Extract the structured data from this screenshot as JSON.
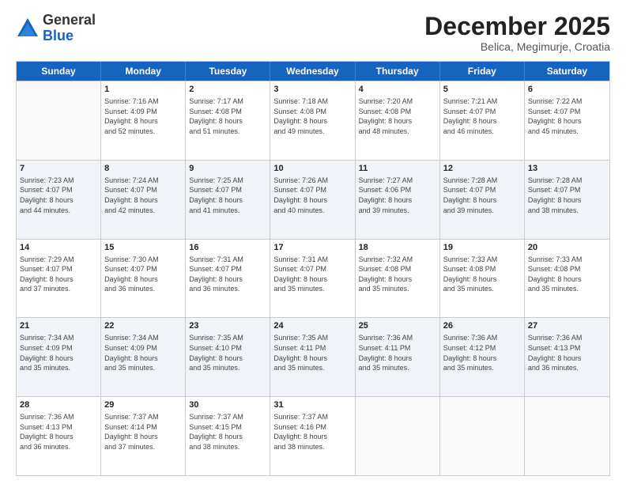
{
  "logo": {
    "general": "General",
    "blue": "Blue"
  },
  "header": {
    "month": "December 2025",
    "location": "Belica, Megimurje, Croatia"
  },
  "weekdays": [
    "Sunday",
    "Monday",
    "Tuesday",
    "Wednesday",
    "Thursday",
    "Friday",
    "Saturday"
  ],
  "rows": [
    [
      {
        "day": "",
        "info": "",
        "empty": true
      },
      {
        "day": "1",
        "info": "Sunrise: 7:16 AM\nSunset: 4:09 PM\nDaylight: 8 hours\nand 52 minutes."
      },
      {
        "day": "2",
        "info": "Sunrise: 7:17 AM\nSunset: 4:08 PM\nDaylight: 8 hours\nand 51 minutes."
      },
      {
        "day": "3",
        "info": "Sunrise: 7:18 AM\nSunset: 4:08 PM\nDaylight: 8 hours\nand 49 minutes."
      },
      {
        "day": "4",
        "info": "Sunrise: 7:20 AM\nSunset: 4:08 PM\nDaylight: 8 hours\nand 48 minutes."
      },
      {
        "day": "5",
        "info": "Sunrise: 7:21 AM\nSunset: 4:07 PM\nDaylight: 8 hours\nand 46 minutes."
      },
      {
        "day": "6",
        "info": "Sunrise: 7:22 AM\nSunset: 4:07 PM\nDaylight: 8 hours\nand 45 minutes."
      }
    ],
    [
      {
        "day": "7",
        "info": "Sunrise: 7:23 AM\nSunset: 4:07 PM\nDaylight: 8 hours\nand 44 minutes."
      },
      {
        "day": "8",
        "info": "Sunrise: 7:24 AM\nSunset: 4:07 PM\nDaylight: 8 hours\nand 42 minutes."
      },
      {
        "day": "9",
        "info": "Sunrise: 7:25 AM\nSunset: 4:07 PM\nDaylight: 8 hours\nand 41 minutes."
      },
      {
        "day": "10",
        "info": "Sunrise: 7:26 AM\nSunset: 4:07 PM\nDaylight: 8 hours\nand 40 minutes."
      },
      {
        "day": "11",
        "info": "Sunrise: 7:27 AM\nSunset: 4:06 PM\nDaylight: 8 hours\nand 39 minutes."
      },
      {
        "day": "12",
        "info": "Sunrise: 7:28 AM\nSunset: 4:07 PM\nDaylight: 8 hours\nand 39 minutes."
      },
      {
        "day": "13",
        "info": "Sunrise: 7:28 AM\nSunset: 4:07 PM\nDaylight: 8 hours\nand 38 minutes."
      }
    ],
    [
      {
        "day": "14",
        "info": "Sunrise: 7:29 AM\nSunset: 4:07 PM\nDaylight: 8 hours\nand 37 minutes."
      },
      {
        "day": "15",
        "info": "Sunrise: 7:30 AM\nSunset: 4:07 PM\nDaylight: 8 hours\nand 36 minutes."
      },
      {
        "day": "16",
        "info": "Sunrise: 7:31 AM\nSunset: 4:07 PM\nDaylight: 8 hours\nand 36 minutes."
      },
      {
        "day": "17",
        "info": "Sunrise: 7:31 AM\nSunset: 4:07 PM\nDaylight: 8 hours\nand 35 minutes."
      },
      {
        "day": "18",
        "info": "Sunrise: 7:32 AM\nSunset: 4:08 PM\nDaylight: 8 hours\nand 35 minutes."
      },
      {
        "day": "19",
        "info": "Sunrise: 7:33 AM\nSunset: 4:08 PM\nDaylight: 8 hours\nand 35 minutes."
      },
      {
        "day": "20",
        "info": "Sunrise: 7:33 AM\nSunset: 4:08 PM\nDaylight: 8 hours\nand 35 minutes."
      }
    ],
    [
      {
        "day": "21",
        "info": "Sunrise: 7:34 AM\nSunset: 4:09 PM\nDaylight: 8 hours\nand 35 minutes."
      },
      {
        "day": "22",
        "info": "Sunrise: 7:34 AM\nSunset: 4:09 PM\nDaylight: 8 hours\nand 35 minutes."
      },
      {
        "day": "23",
        "info": "Sunrise: 7:35 AM\nSunset: 4:10 PM\nDaylight: 8 hours\nand 35 minutes."
      },
      {
        "day": "24",
        "info": "Sunrise: 7:35 AM\nSunset: 4:11 PM\nDaylight: 8 hours\nand 35 minutes."
      },
      {
        "day": "25",
        "info": "Sunrise: 7:36 AM\nSunset: 4:11 PM\nDaylight: 8 hours\nand 35 minutes."
      },
      {
        "day": "26",
        "info": "Sunrise: 7:36 AM\nSunset: 4:12 PM\nDaylight: 8 hours\nand 35 minutes."
      },
      {
        "day": "27",
        "info": "Sunrise: 7:36 AM\nSunset: 4:13 PM\nDaylight: 8 hours\nand 36 minutes."
      }
    ],
    [
      {
        "day": "28",
        "info": "Sunrise: 7:36 AM\nSunset: 4:13 PM\nDaylight: 8 hours\nand 36 minutes."
      },
      {
        "day": "29",
        "info": "Sunrise: 7:37 AM\nSunset: 4:14 PM\nDaylight: 8 hours\nand 37 minutes."
      },
      {
        "day": "30",
        "info": "Sunrise: 7:37 AM\nSunset: 4:15 PM\nDaylight: 8 hours\nand 38 minutes."
      },
      {
        "day": "31",
        "info": "Sunrise: 7:37 AM\nSunset: 4:16 PM\nDaylight: 8 hours\nand 38 minutes."
      },
      {
        "day": "",
        "info": "",
        "empty": true
      },
      {
        "day": "",
        "info": "",
        "empty": true
      },
      {
        "day": "",
        "info": "",
        "empty": true
      }
    ]
  ]
}
